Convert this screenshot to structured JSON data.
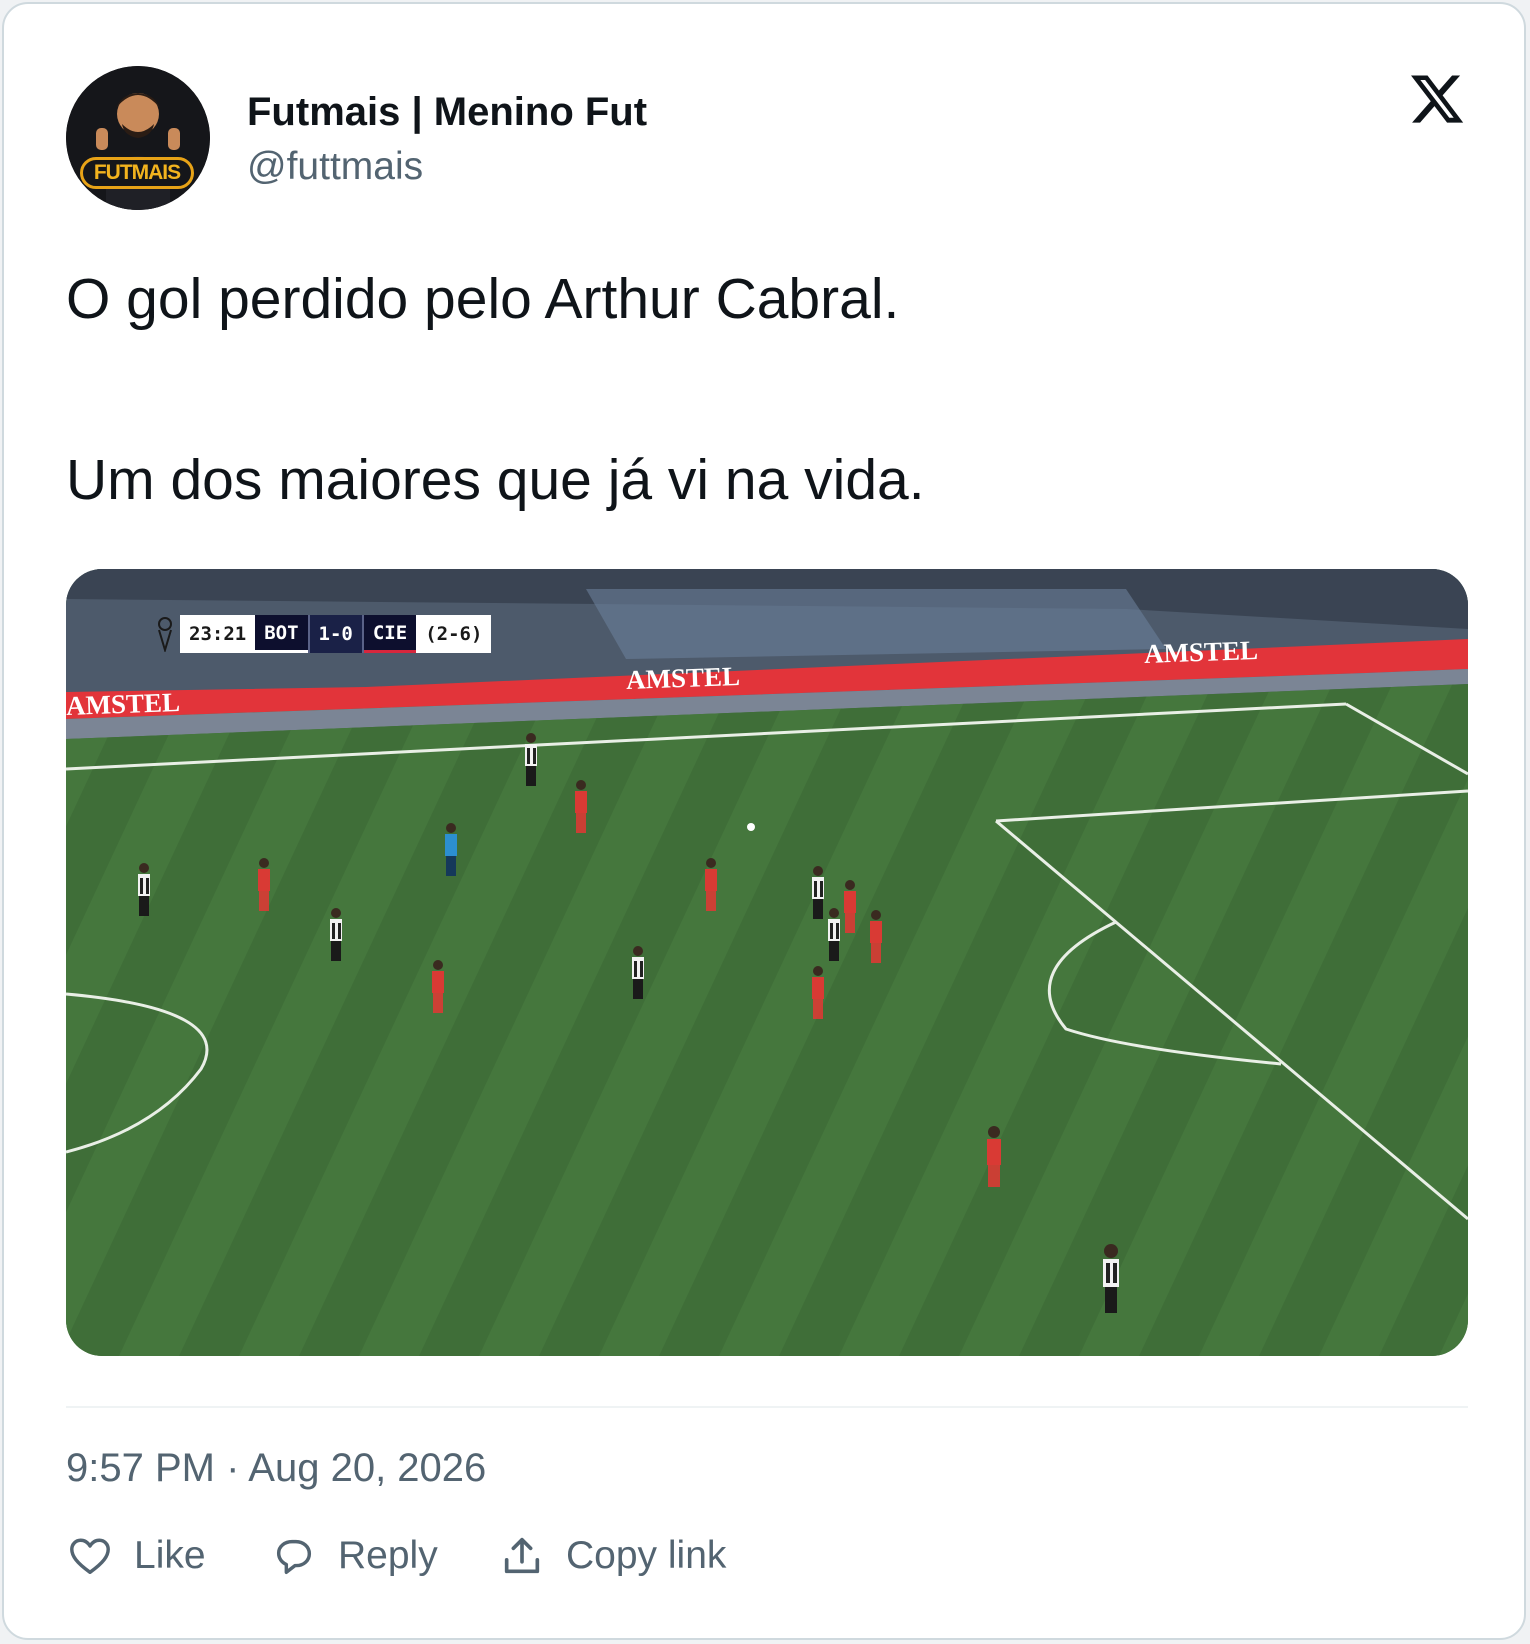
{
  "tweet": {
    "author": {
      "display_name": "Futmais | Menino Fut",
      "handle": "@futtmais",
      "avatar_brand": "FUTMAIS"
    },
    "text_lines": [
      "O gol perdido pelo Arthur Cabral.",
      "Um dos maiores que já vi na vida."
    ],
    "timestamp": "9:57 PM · Aug 20, 2026",
    "platform_icon": "x-logo-icon"
  },
  "media": {
    "scorebug": {
      "clock": "23:21",
      "home": "BOT",
      "score": "1-0",
      "away": "CIE",
      "aggregate": "(2-6)"
    },
    "board_ads": [
      "AMSTEL",
      "AMSTEL",
      "AMSTEL"
    ]
  },
  "actions": {
    "like": {
      "label": "Like",
      "icon": "heart-icon"
    },
    "reply": {
      "label": "Reply",
      "icon": "speech-bubble-icon"
    },
    "copy_link": {
      "label": "Copy link",
      "icon": "upload-arrow-icon"
    }
  },
  "colors": {
    "text_primary": "#0f1419",
    "text_secondary": "#536471",
    "border": "#cfd9de",
    "pitch": "#3f6e38",
    "home_kit": "#f2f2f2",
    "away_kit": "#d93a34",
    "ad_board": "#e2343a"
  }
}
